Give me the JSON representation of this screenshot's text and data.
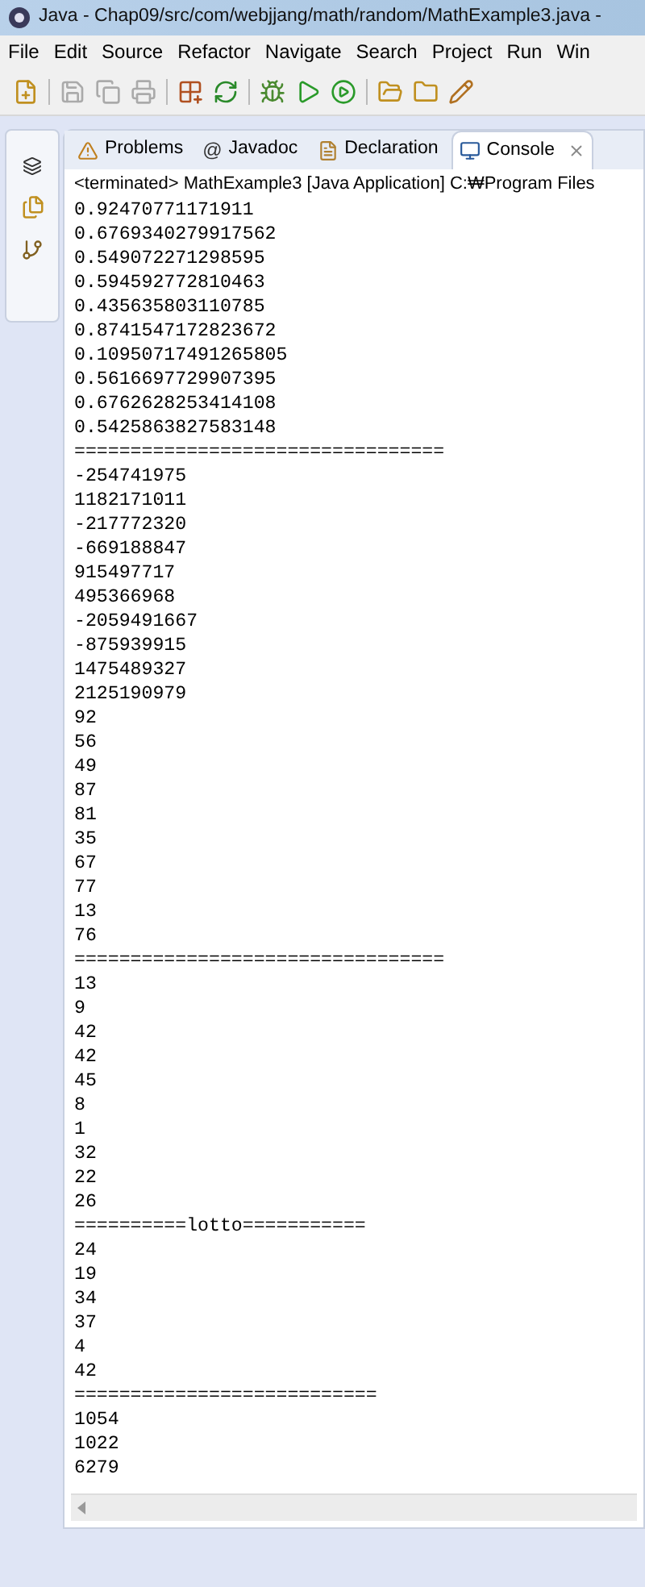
{
  "window": {
    "title": "Java - Chap09/src/com/webjjang/math/random/MathExample3.java -"
  },
  "menu": [
    "File",
    "Edit",
    "Source",
    "Refactor",
    "Navigate",
    "Search",
    "Project",
    "Run",
    "Win"
  ],
  "tabs": [
    {
      "label": "Problems",
      "selected": false
    },
    {
      "label": "Javadoc",
      "glyph": "@",
      "selected": false
    },
    {
      "label": "Declaration",
      "selected": false
    },
    {
      "label": "Console",
      "selected": true
    }
  ],
  "console": {
    "header": "<terminated> MathExample3 [Java Application] C:₩Program Files",
    "lines": [
      "0.92470771171911",
      "0.6769340279917562",
      "0.549072271298595",
      "0.594592772810463",
      "0.435635803110785",
      "0.8741547172823672",
      "0.10950717491265805",
      "0.5616697729907395",
      "0.6762628253414108",
      "0.5425863827583148",
      "=================================",
      "-254741975",
      "1182171011",
      "-217772320",
      "-669188847",
      "915497717",
      "495366968",
      "-2059491667",
      "-875939915",
      "1475489327",
      "2125190979",
      "92",
      "56",
      "49",
      "87",
      "81",
      "35",
      "67",
      "77",
      "13",
      "76",
      "=================================",
      "13",
      "9",
      "42",
      "42",
      "45",
      "8",
      "1",
      "32",
      "22",
      "26",
      "==========lotto===========",
      "24",
      "19",
      "34",
      "37",
      "4",
      "42",
      "===========================",
      "1054",
      "1022",
      "6279"
    ]
  }
}
